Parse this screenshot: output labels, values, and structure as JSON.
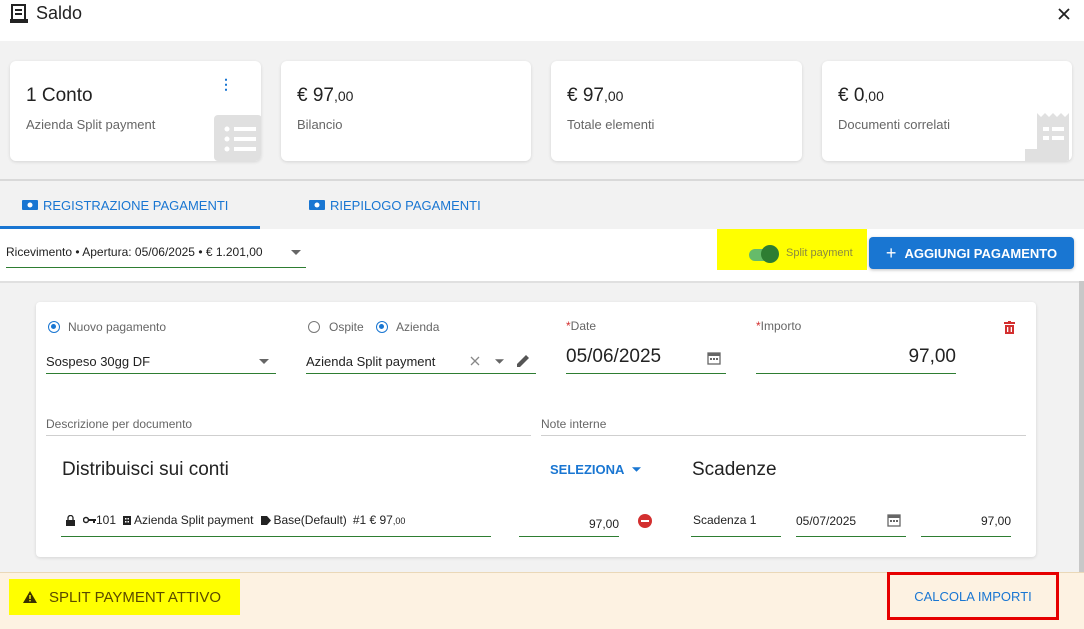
{
  "window": {
    "title": "Saldo",
    "close_icon": "close-icon"
  },
  "summary_cards": [
    {
      "main": "1 Conto",
      "sub": "Azienda Split payment",
      "icon": "list-icon"
    },
    {
      "main_int": "€ 97",
      "main_dec": ",00",
      "sub": "Bilancio"
    },
    {
      "main_int": "€ 97",
      "main_dec": ",00",
      "sub": "Totale elementi"
    },
    {
      "main_int": "€ 0",
      "main_dec": ",00",
      "sub": "Documenti correlati",
      "icon": "receipt-icon"
    }
  ],
  "tabs": [
    {
      "label": "REGISTRAZIONE PAGAMENTI",
      "active": true
    },
    {
      "label": "RIEPILOGO PAGAMENTI",
      "active": false
    }
  ],
  "toolbar": {
    "receipt_value": "Ricevimento • Apertura: 05/06/2025 • € 1.201,00",
    "split_toggle_label": "Split payment",
    "split_toggle_on": true,
    "add_payment_label": "AGGIUNGI PAGAMENTO"
  },
  "payment_form": {
    "radio_new_payment": "Nuovo pagamento",
    "payment_type_value": "Sospeso 30gg DF",
    "radio_guest": "Ospite",
    "radio_company": "Azienda",
    "company_value": "Azienda Split payment",
    "date_label": "Date",
    "date_value": "05/06/2025",
    "amount_label": "Importo",
    "amount_value": "97,00",
    "description_placeholder": "Descrizione per documento",
    "internal_notes_placeholder": "Note interne"
  },
  "distribution": {
    "title": "Distribuisci sui conti",
    "select_label": "SELEZIONA",
    "account_number": "101",
    "account_name": "Azienda Split payment",
    "account_rate": "Base(Default)",
    "account_ref": "#1 € 97",
    "account_ref_dec": ",00",
    "amount": "97,00"
  },
  "deadlines": {
    "title": "Scadenze",
    "name": "Scadenza 1",
    "date": "05/07/2025",
    "amount": "97,00"
  },
  "bottom": {
    "split_active_label": "SPLIT PAYMENT ATTIVO",
    "calc_label": "CALCOLA IMPORTI"
  },
  "colors": {
    "primary": "#1976d2",
    "field_underline": "#2e7d32",
    "highlight": "#ffff00",
    "danger": "#d32f2f",
    "warning_bar": "#fdf2e2"
  }
}
